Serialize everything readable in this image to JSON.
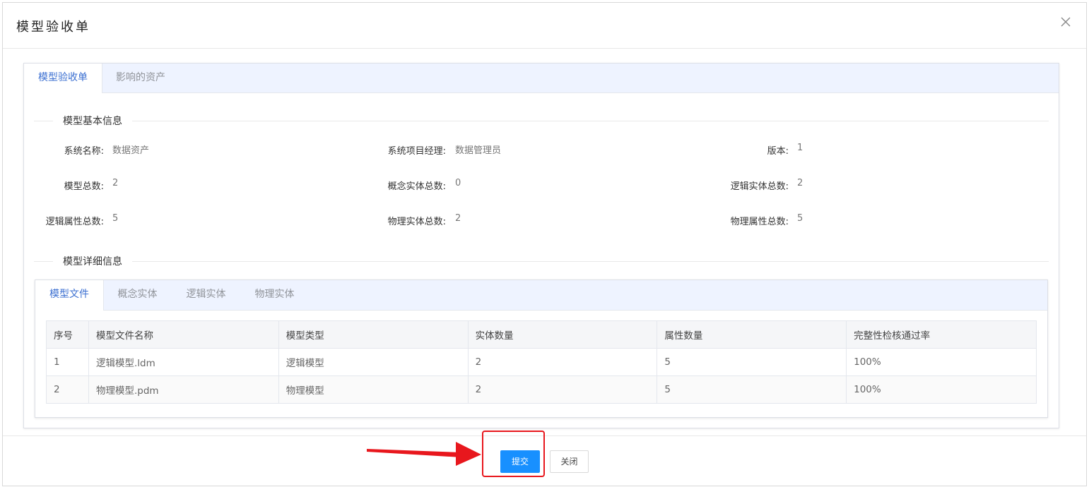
{
  "modal": {
    "title": "模型验收单"
  },
  "tabs": [
    {
      "label": "模型验收单",
      "active": true
    },
    {
      "label": "影响的资产",
      "active": false
    }
  ],
  "basic_info": {
    "section_title": "模型基本信息",
    "fields": [
      {
        "label": "系统名称:",
        "value": "数据资产"
      },
      {
        "label": "系统项目经理:",
        "value": "数据管理员"
      },
      {
        "label": "版本:",
        "value": "1"
      },
      {
        "label": "模型总数:",
        "value": "2"
      },
      {
        "label": "概念实体总数:",
        "value": "0"
      },
      {
        "label": "逻辑实体总数:",
        "value": "2"
      },
      {
        "label": "逻辑属性总数:",
        "value": "5"
      },
      {
        "label": "物理实体总数:",
        "value": "2"
      },
      {
        "label": "物理属性总数:",
        "value": "5"
      }
    ]
  },
  "detail_info": {
    "section_title": "模型详细信息",
    "tabs": [
      {
        "label": "模型文件",
        "active": true
      },
      {
        "label": "概念实体",
        "active": false
      },
      {
        "label": "逻辑实体",
        "active": false
      },
      {
        "label": "物理实体",
        "active": false
      }
    ],
    "table": {
      "columns": [
        "序号",
        "模型文件名称",
        "模型类型",
        "实体数量",
        "属性数量",
        "完整性检核通过率"
      ],
      "rows": [
        [
          "1",
          "逻辑模型.ldm",
          "逻辑模型",
          "2",
          "5",
          "100%"
        ],
        [
          "2",
          "物理模型.pdm",
          "物理模型",
          "2",
          "5",
          "100%"
        ]
      ]
    }
  },
  "footer": {
    "submit_label": "提交",
    "close_label": "关闭"
  },
  "colors": {
    "primary": "#1890ff",
    "active_tab_text": "#3b6fd1",
    "tab_bar_bg": "#eef3ff",
    "annotation_red": "#e8171d"
  },
  "icons": {
    "close": "close-icon",
    "annotation_arrow": "arrow-icon"
  }
}
